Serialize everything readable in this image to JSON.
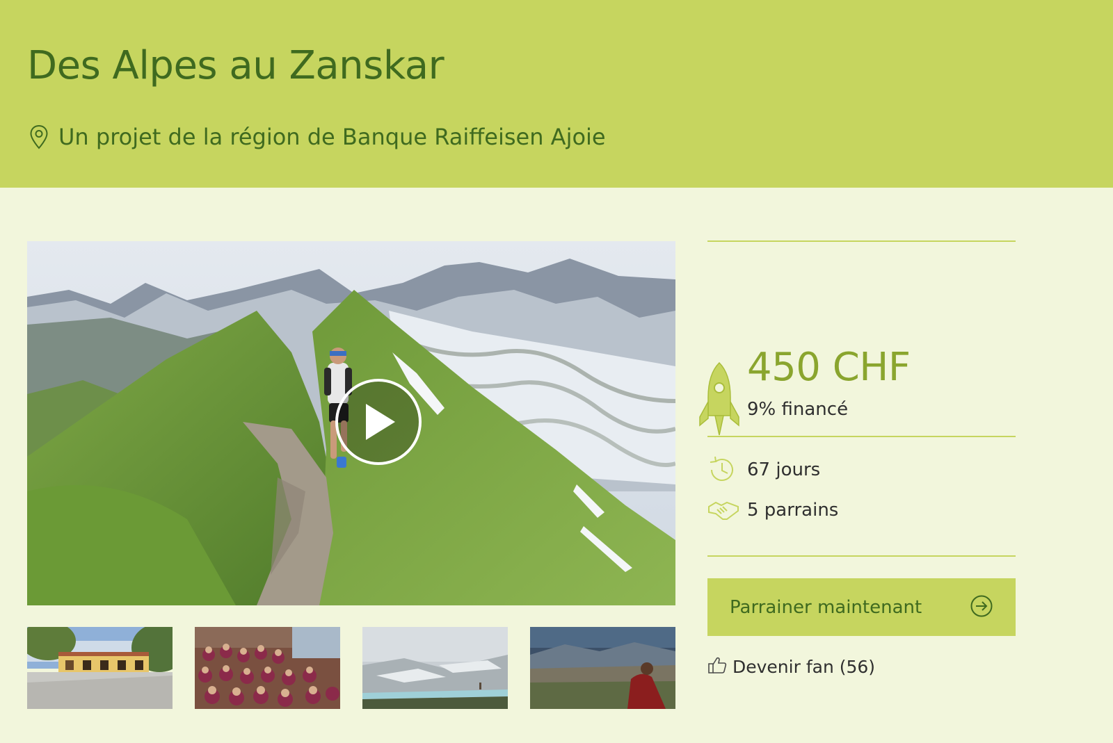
{
  "header": {
    "title": "Des Alpes au Zanskar",
    "region_text": "Un projet de la région de Banque Raiffeisen Ajoie"
  },
  "media": {
    "main_icon": "play-icon",
    "thumbnails": [
      {
        "name": "thumbnail-school-building"
      },
      {
        "name": "thumbnail-classroom-children"
      },
      {
        "name": "thumbnail-glacier-fog"
      },
      {
        "name": "thumbnail-monk-valley"
      }
    ]
  },
  "funding": {
    "amount": "450 CHF",
    "funded_text": "9% financé",
    "funded_fraction": 0.09,
    "days_text": "67 jours",
    "sponsors_text": "5 parrains",
    "cta_label": "Parrainer maintenant",
    "fan_label": "Devenir fan (56)"
  },
  "colors": {
    "header_bg": "#c6d55f",
    "page_bg": "#f2f6dc",
    "title_text": "#3f6a1f",
    "amount_text": "#8aa52e",
    "accent": "#c6d55f"
  }
}
